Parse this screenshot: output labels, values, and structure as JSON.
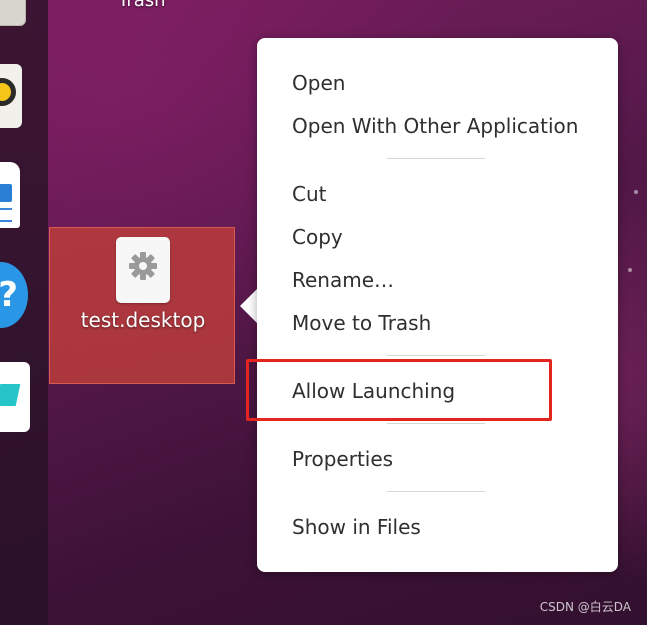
{
  "desktop": {
    "top_label": "Trash",
    "selected_file": {
      "name": "test.desktop",
      "icon": "gear-icon"
    }
  },
  "dock": {
    "items": [
      {
        "icon": "files-icon"
      },
      {
        "icon": "rhythmbox-icon"
      },
      {
        "icon": "libreoffice-writer-icon"
      },
      {
        "icon": "help-icon",
        "glyph": "?"
      },
      {
        "icon": "software-center-icon"
      }
    ]
  },
  "context_menu": {
    "open": "Open",
    "open_with": "Open With Other Application",
    "cut": "Cut",
    "copy": "Copy",
    "rename": "Rename…",
    "move_to_trash": "Move to Trash",
    "allow_launching": "Allow Launching",
    "properties": "Properties",
    "show_in_files": "Show in Files"
  },
  "annotation": {
    "color": "#e3241f",
    "highlights": "allow_launching"
  },
  "watermark": "CSDN @白云DA",
  "colors": {
    "selection": "#be3e3a",
    "menu_bg": "#ffffff",
    "menu_text": "#2f2f2f"
  }
}
